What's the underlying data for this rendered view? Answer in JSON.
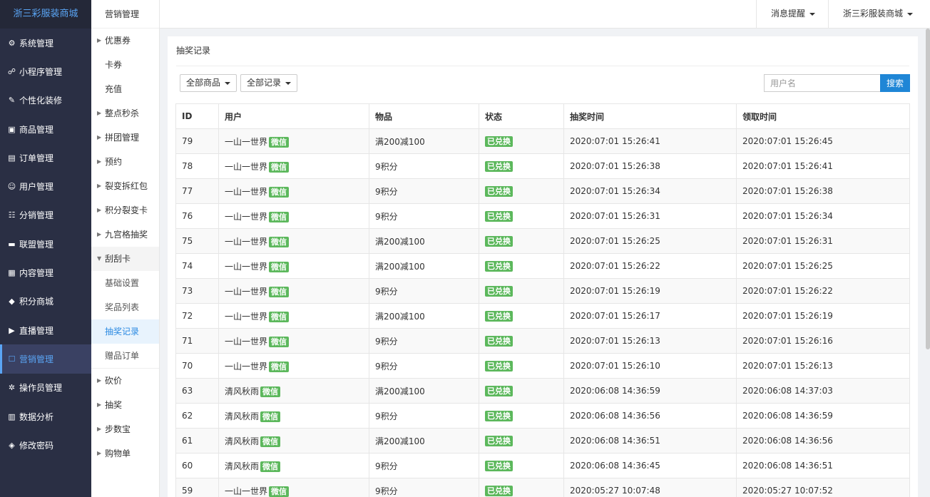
{
  "brand": "浙三彩服装商城",
  "sidebar": {
    "items": [
      {
        "label": "系统管理",
        "icon": "gear-icon",
        "glyph": "⚙"
      },
      {
        "label": "小程序管理",
        "icon": "link-icon",
        "glyph": "☍"
      },
      {
        "label": "个性化装修",
        "icon": "palette-icon",
        "glyph": "✎"
      },
      {
        "label": "商品管理",
        "icon": "bag-icon",
        "glyph": "▣"
      },
      {
        "label": "订单管理",
        "icon": "order-icon",
        "glyph": "▤"
      },
      {
        "label": "用户管理",
        "icon": "user-icon",
        "glyph": "☺"
      },
      {
        "label": "分销管理",
        "icon": "network-icon",
        "glyph": "☷"
      },
      {
        "label": "联盟管理",
        "icon": "store-icon",
        "glyph": "▬"
      },
      {
        "label": "内容管理",
        "icon": "content-icon",
        "glyph": "▦"
      },
      {
        "label": "积分商城",
        "icon": "box-icon",
        "glyph": "◆"
      },
      {
        "label": "直播管理",
        "icon": "play-icon",
        "glyph": "▶"
      },
      {
        "label": "营销管理",
        "icon": "marketing-icon",
        "glyph": "☐"
      },
      {
        "label": "操作员管理",
        "icon": "operator-gear-icon",
        "glyph": "✲"
      },
      {
        "label": "数据分析",
        "icon": "bar-chart-icon",
        "glyph": "▥"
      },
      {
        "label": "修改密码",
        "icon": "shield-icon",
        "glyph": "◈"
      }
    ],
    "active_index": 11
  },
  "submenu": {
    "title": "营销管理",
    "items": [
      {
        "label": "优惠券",
        "arrow": "right"
      },
      {
        "label": "卡券",
        "arrow": "none"
      },
      {
        "label": "充值",
        "arrow": "none"
      },
      {
        "label": "整点秒杀",
        "arrow": "right"
      },
      {
        "label": "拼团管理",
        "arrow": "right"
      },
      {
        "label": "预约",
        "arrow": "right"
      },
      {
        "label": "裂变拆红包",
        "arrow": "right"
      },
      {
        "label": "积分裂变卡",
        "arrow": "right"
      },
      {
        "label": "九宫格抽奖",
        "arrow": "right"
      },
      {
        "label": "刮刮卡",
        "arrow": "down"
      }
    ],
    "children": [
      "基础设置",
      "奖品列表",
      "抽奖记录",
      "赠品订单"
    ],
    "active_child": 2,
    "after": [
      {
        "label": "砍价"
      },
      {
        "label": "抽奖"
      },
      {
        "label": "步数宝"
      },
      {
        "label": "购物单"
      }
    ]
  },
  "header": {
    "notify_label": "消息提醒",
    "store_label": "浙三彩服装商城"
  },
  "page": {
    "title": "抽奖记录",
    "filter_goods": "全部商品",
    "filter_records": "全部记录",
    "search_placeholder": "用户名",
    "search_label": "搜索"
  },
  "table": {
    "headers": [
      "ID",
      "用户",
      "物品",
      "状态",
      "抽奖时间",
      "领取时间"
    ],
    "rows": [
      {
        "id": "79",
        "user": "一山一世界",
        "tag": "微信",
        "item": "满200减100",
        "status": "已兑换",
        "draw_time": "2020:07:01 15:26:41",
        "claim_time": "2020:07:01 15:26:45"
      },
      {
        "id": "78",
        "user": "一山一世界",
        "tag": "微信",
        "item": "9积分",
        "status": "已兑换",
        "draw_time": "2020:07:01 15:26:38",
        "claim_time": "2020:07:01 15:26:41"
      },
      {
        "id": "77",
        "user": "一山一世界",
        "tag": "微信",
        "item": "9积分",
        "status": "已兑换",
        "draw_time": "2020:07:01 15:26:34",
        "claim_time": "2020:07:01 15:26:38"
      },
      {
        "id": "76",
        "user": "一山一世界",
        "tag": "微信",
        "item": "9积分",
        "status": "已兑换",
        "draw_time": "2020:07:01 15:26:31",
        "claim_time": "2020:07:01 15:26:34"
      },
      {
        "id": "75",
        "user": "一山一世界",
        "tag": "微信",
        "item": "满200减100",
        "status": "已兑换",
        "draw_time": "2020:07:01 15:26:25",
        "claim_time": "2020:07:01 15:26:31"
      },
      {
        "id": "74",
        "user": "一山一世界",
        "tag": "微信",
        "item": "满200减100",
        "status": "已兑换",
        "draw_time": "2020:07:01 15:26:22",
        "claim_time": "2020:07:01 15:26:25"
      },
      {
        "id": "73",
        "user": "一山一世界",
        "tag": "微信",
        "item": "9积分",
        "status": "已兑换",
        "draw_time": "2020:07:01 15:26:19",
        "claim_time": "2020:07:01 15:26:22"
      },
      {
        "id": "72",
        "user": "一山一世界",
        "tag": "微信",
        "item": "满200减100",
        "status": "已兑换",
        "draw_time": "2020:07:01 15:26:17",
        "claim_time": "2020:07:01 15:26:19"
      },
      {
        "id": "71",
        "user": "一山一世界",
        "tag": "微信",
        "item": "9积分",
        "status": "已兑换",
        "draw_time": "2020:07:01 15:26:13",
        "claim_time": "2020:07:01 15:26:16"
      },
      {
        "id": "70",
        "user": "一山一世界",
        "tag": "微信",
        "item": "9积分",
        "status": "已兑换",
        "draw_time": "2020:07:01 15:26:10",
        "claim_time": "2020:07:01 15:26:13"
      },
      {
        "id": "63",
        "user": "清风秋雨",
        "tag": "微信",
        "item": "满200减100",
        "status": "已兑换",
        "draw_time": "2020:06:08 14:36:59",
        "claim_time": "2020:06:08 14:37:03"
      },
      {
        "id": "62",
        "user": "清风秋雨",
        "tag": "微信",
        "item": "9积分",
        "status": "已兑换",
        "draw_time": "2020:06:08 14:36:56",
        "claim_time": "2020:06:08 14:36:59"
      },
      {
        "id": "61",
        "user": "清风秋雨",
        "tag": "微信",
        "item": "满200减100",
        "status": "已兑换",
        "draw_time": "2020:06:08 14:36:51",
        "claim_time": "2020:06:08 14:36:56"
      },
      {
        "id": "60",
        "user": "清风秋雨",
        "tag": "微信",
        "item": "9积分",
        "status": "已兑换",
        "draw_time": "2020:06:08 14:36:45",
        "claim_time": "2020:06:08 14:36:51"
      },
      {
        "id": "59",
        "user": "一山一世界",
        "tag": "微信",
        "item": "9积分",
        "status": "已兑换",
        "draw_time": "2020:05:27 10:07:48",
        "claim_time": "2020:05:27 10:07:52"
      }
    ]
  },
  "colors": {
    "sidebar_bg": "#2a2f44",
    "accent": "#5aa5f5",
    "tag_green": "#5cb85c",
    "search_blue": "#1f86d6"
  }
}
